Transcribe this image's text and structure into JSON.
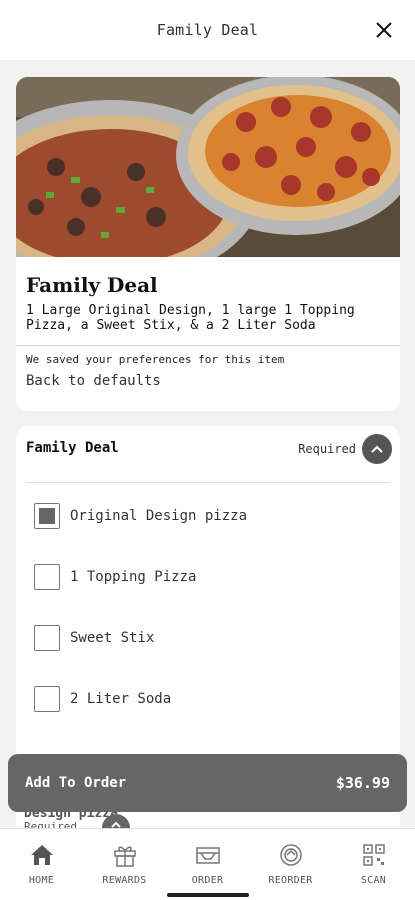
{
  "header": {
    "title": "Family Deal"
  },
  "item": {
    "name": "Family Deal",
    "description": "1 Large Original Design, 1 large 1 Topping Pizza, a Sweet Stix, & a 2 Liter Soda",
    "saved_note": "We saved your preferences for this item",
    "back_link": "Back to defaults"
  },
  "group": {
    "title": "Family Deal",
    "required_label": "Required",
    "options": [
      {
        "label": "Original Design pizza",
        "checked": true
      },
      {
        "label": "1 Topping Pizza",
        "checked": false
      },
      {
        "label": "Sweet Stix",
        "checked": false
      },
      {
        "label": "2 Liter Soda",
        "checked": false
      }
    ]
  },
  "peek": {
    "title": "Design pizza",
    "required_label": "Required"
  },
  "cta": {
    "label": "Add To Order",
    "price": "$36.99"
  },
  "nav": [
    {
      "label": "HOME",
      "icon": "home-icon"
    },
    {
      "label": "REWARDS",
      "icon": "gift-icon"
    },
    {
      "label": "ORDER",
      "icon": "order-icon"
    },
    {
      "label": "REORDER",
      "icon": "reorder-icon"
    },
    {
      "label": "SCAN",
      "icon": "qr-scan-icon"
    }
  ],
  "colors": {
    "button": "#666666",
    "background": "#f2f2f2"
  }
}
